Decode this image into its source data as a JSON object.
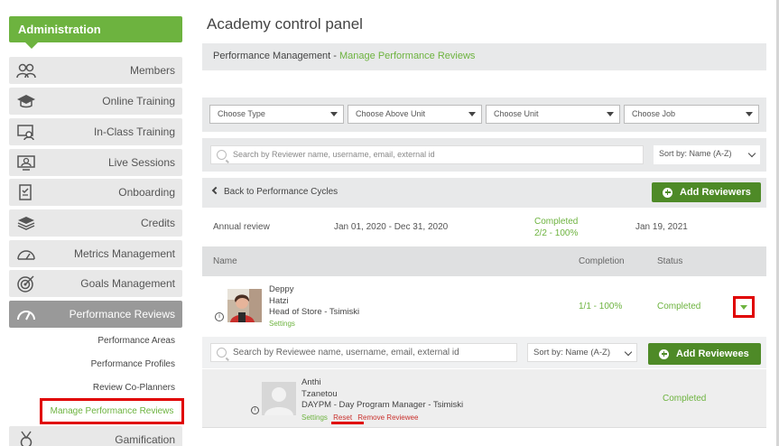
{
  "sidebar": {
    "header": "Administration",
    "items": [
      {
        "label": "Members",
        "icon": "members-icon"
      },
      {
        "label": "Online Training",
        "icon": "graduation-cap-icon"
      },
      {
        "label": "In-Class Training",
        "icon": "classroom-icon"
      },
      {
        "label": "Live Sessions",
        "icon": "live-session-icon"
      },
      {
        "label": "Onboarding",
        "icon": "checklist-icon"
      },
      {
        "label": "Credits",
        "icon": "stack-icon"
      },
      {
        "label": "Metrics Management",
        "icon": "gauge-icon"
      },
      {
        "label": "Goals Management",
        "icon": "target-icon"
      },
      {
        "label": "Performance Reviews",
        "icon": "speedometer-icon"
      },
      {
        "label": "Gamification",
        "icon": "medal-icon"
      }
    ],
    "subitems": [
      "Performance Areas",
      "Performance Profiles",
      "Review Co-Planners",
      "Manage Performance Reviews"
    ]
  },
  "page": {
    "title": "Academy control panel",
    "breadcrumb_root": "Performance Management",
    "breadcrumb_sep": " - ",
    "breadcrumb_current": "Manage Performance Reviews"
  },
  "filters": {
    "type": "Choose Type",
    "above_unit": "Choose Above Unit",
    "unit": "Choose Unit",
    "job": "Choose Job"
  },
  "reviewer_search": {
    "placeholder": "Search by Reviewer name, username, email, external id",
    "sort": "Sort by: Name (A-Z)"
  },
  "cycle": {
    "back": "Back to Performance Cycles",
    "add_reviewers": "Add Reviewers",
    "name": "Annual review",
    "range": "Jan 01, 2020 - Dec 31, 2020",
    "status": "Completed",
    "progress": "2/2 - 100%",
    "date": "Jan 19, 2021"
  },
  "table": {
    "col_name": "Name",
    "col_completion": "Completion",
    "col_status": "Status"
  },
  "reviewer": {
    "first": "Deppy",
    "last": "Hatzi",
    "role": "Head of Store - Tsimiski",
    "settings": "Settings",
    "completion": "1/1 - 100%",
    "status": "Completed"
  },
  "reviewee_search": {
    "placeholder": "Search by Reviewee name, username, email, external id",
    "sort": "Sort by: Name (A-Z)",
    "add_reviewees": "Add Reviewees"
  },
  "reviewee": {
    "first": "Anthi",
    "last": "Tzanetou",
    "role": "DAYPM - Day Program Manager - Tsimiski",
    "settings": "Settings",
    "reset": "Reset",
    "remove": "Remove Reviewee",
    "status": "Completed"
  },
  "colors": {
    "brand_green": "#6db33f",
    "button_green": "#4e8a27",
    "highlight_red": "#e00000"
  }
}
